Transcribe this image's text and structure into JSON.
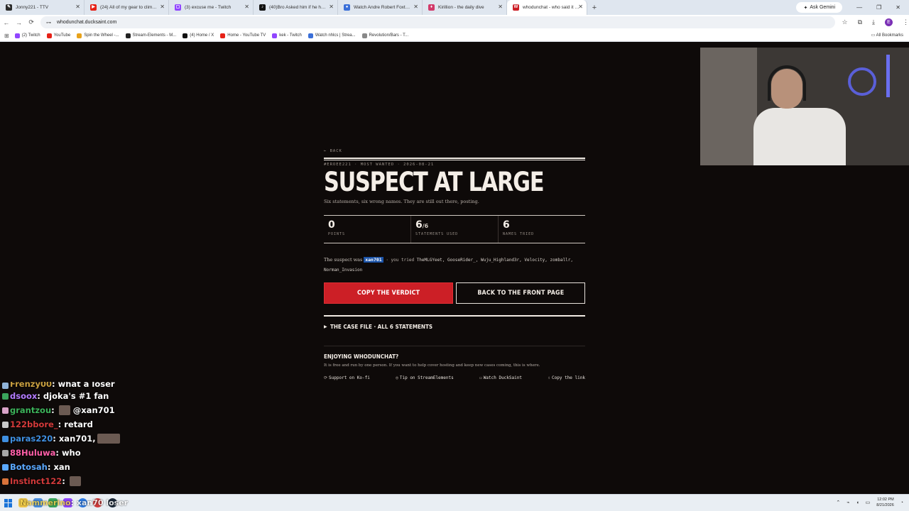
{
  "browser": {
    "tabs": [
      {
        "label": "Jonny221 - TTV",
        "color": "#2b2b2b",
        "glyph": "✎"
      },
      {
        "label": "(24) All of my gear to climb Mc",
        "color": "#e62117",
        "glyph": "▶"
      },
      {
        "label": "(3) excuse me - Twitch",
        "color": "#9146ff",
        "glyph": "▢"
      },
      {
        "label": "(40)Bro Asked him if he had a",
        "color": "#111111",
        "glyph": "♪"
      },
      {
        "label": "Watch Andre Robert Foxtner Jr",
        "color": "#3a6fd8",
        "glyph": "●"
      },
      {
        "label": "Kirillion - the daily dive",
        "color": "#d23a6a",
        "glyph": "♦"
      },
      {
        "label": "whodunchat - who said it in yo",
        "color": "#cc1f26",
        "glyph": "W"
      }
    ],
    "ask_gemini": "Ask Gemini",
    "url": "whodunchat.ducksaint.com",
    "bookmarks": [
      {
        "label": "(2) Twitch",
        "color": "#9146ff"
      },
      {
        "label": "YouTube",
        "color": "#e62117"
      },
      {
        "label": "Spin the Wheel -...",
        "color": "#e8a21a"
      },
      {
        "label": "Stream-Elements - M...",
        "color": "#222222"
      },
      {
        "label": "(4) Home / X",
        "color": "#111111"
      },
      {
        "label": "Home - YouTube TV",
        "color": "#e62117"
      },
      {
        "label": "kek - Twitch",
        "color": "#9146ff"
      },
      {
        "label": "Watch nhlcs | Strea...",
        "color": "#3a6fd8"
      },
      {
        "label": "Revolution/Bars - T...",
        "color": "#888888"
      }
    ],
    "all_bookmarks": "All Bookmarks",
    "profile_initial": "E"
  },
  "article": {
    "back": "← BACK",
    "meta": "#EROEE221 · MOST WANTED · 2026-08-21",
    "headline": "SUSPECT AT LARGE",
    "subline": "Six statements, six wrong names. They are still out there, posting.",
    "stats": [
      {
        "num": "0",
        "of": "",
        "label": "POINTS"
      },
      {
        "num": "6",
        "of": "/6",
        "label": "STATEMENTS USED"
      },
      {
        "num": "6",
        "of": "",
        "label": "NAMES TRIED"
      }
    ],
    "verdict_lead": "The suspect was",
    "verdict_answer": "xan701",
    "verdict_sep": " · you tried ",
    "tried_names": "TheMLGYeet, GooseRider_, Wuju_Highland3r, Velocity, zomballr, Norman_Invasion",
    "copy_btn": "COPY THE VERDICT",
    "front_btn": "BACK TO THE FRONT PAGE",
    "case_file": "THE CASE FILE · ALL 6 STATEMENTS",
    "enjoy_title": "ENJOYING WHODUNCHAT?",
    "enjoy_text": "It is free and run by one person. If you want to help cover hosting and keep new cases coming, this is where.",
    "links": [
      {
        "icon": "⟳",
        "label": "Support on Ko-fi"
      },
      {
        "icon": "◎",
        "label": "Tip on StreamElements"
      },
      {
        "icon": "▭",
        "label": "Watch DuckSaint"
      },
      {
        "icon": "⇪",
        "label": "Copy the link"
      }
    ]
  },
  "chat": [
    {
      "user": "Frenzy00",
      "color": "#c9a040",
      "msg": "what a loser",
      "emote": "",
      "cut": true
    },
    {
      "user": "dsoox",
      "color": "#b37cff",
      "msg": "djoka's #1 fan",
      "emote": ""
    },
    {
      "user": "grantzou",
      "color": "#3cb35a",
      "msg": "@xan701",
      "emote": "before"
    },
    {
      "user": "122bbore_",
      "color": "#d33a3a",
      "msg": "retard",
      "emote": ""
    },
    {
      "user": "paras220",
      "color": "#3f8fe0",
      "msg": "xan701,",
      "emote": "wide"
    },
    {
      "user": "88Huluwa",
      "color": "#ff5fa8",
      "msg": "who",
      "emote": ""
    },
    {
      "user": "Botosah",
      "color": "#5aa8ff",
      "msg": "xan",
      "emote": ""
    },
    {
      "user": "Instinct122",
      "color": "#d33a3a",
      "msg": "",
      "emote": "after"
    }
  ],
  "taskbar": {
    "chat_user": "Nammerino",
    "chat_msg": "xan70 loser",
    "time": "12:02 PM",
    "date": "8/21/2026"
  }
}
